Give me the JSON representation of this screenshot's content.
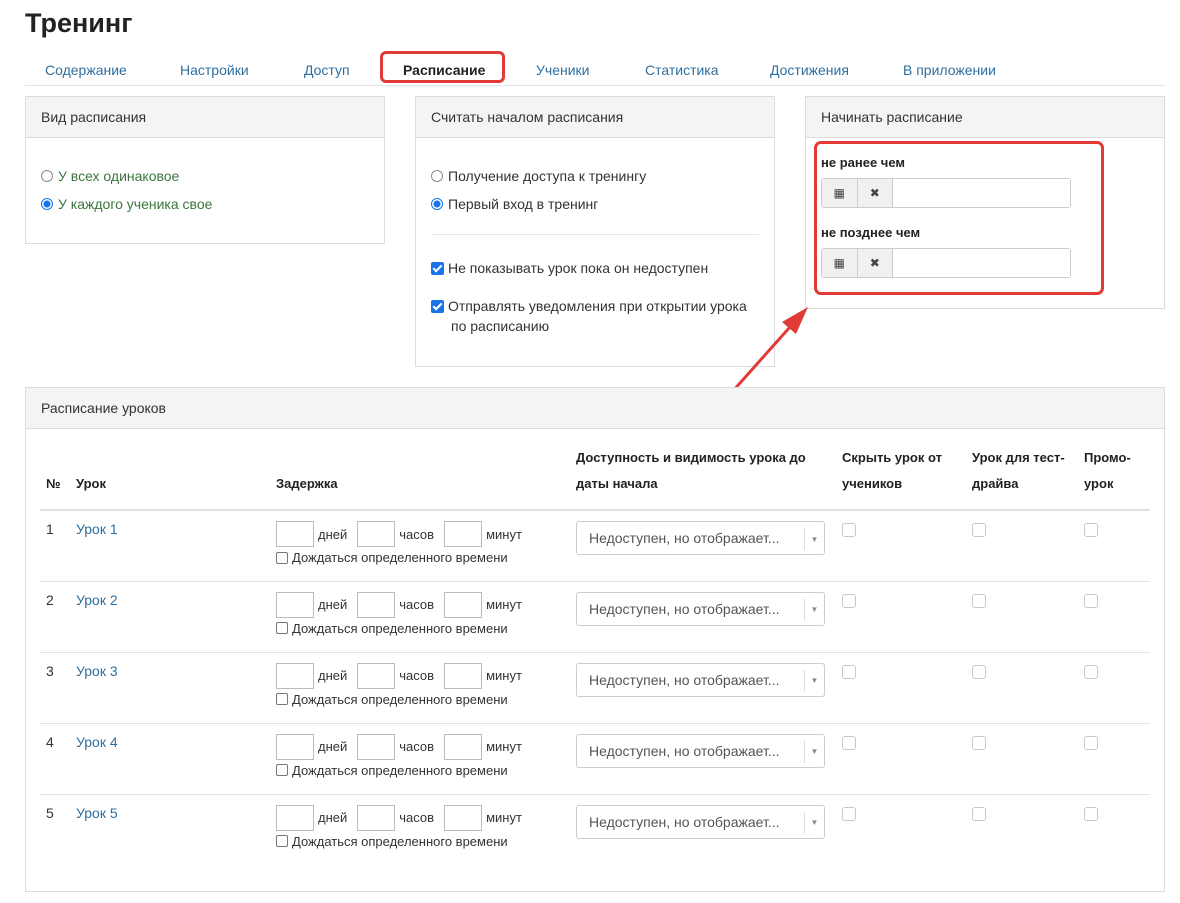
{
  "page": {
    "title": "Тренинг"
  },
  "tabs": [
    {
      "label": "Содержание"
    },
    {
      "label": "Настройки"
    },
    {
      "label": "Доступ"
    },
    {
      "label": "Расписание"
    },
    {
      "label": "Ученики"
    },
    {
      "label": "Статистика"
    },
    {
      "label": "Достижения"
    },
    {
      "label": "В приложении"
    }
  ],
  "schedule_type": {
    "heading": "Вид расписания",
    "options": [
      "У всех одинаковое",
      "У каждого ученика свое"
    ]
  },
  "schedule_start_point": {
    "heading": "Считать началом расписания",
    "options": [
      "Получение доступа к тренингу",
      "Первый вход в тренинг"
    ],
    "checkboxes": [
      {
        "label": "Не показывать урок пока он недоступен"
      },
      {
        "label_line1": "Отправлять уведомления при открытии урока",
        "label_line2": "по расписанию"
      }
    ]
  },
  "start_schedule": {
    "heading": "Начинать расписание",
    "not_earlier_label": "не ранее чем",
    "not_later_label": "не позднее чем"
  },
  "lessons": {
    "heading": "Расписание уроков",
    "columns": {
      "num": "№",
      "lesson": "Урок",
      "delay": "Задержка",
      "availability_line1": "Доступность и видимость урока до",
      "availability_line2": "даты начала",
      "hide_line1": "Скрыть урок от",
      "hide_line2": "учеников",
      "test_line1": "Урок для тест-",
      "test_line2": "драйва",
      "promo_line1": "Промо-",
      "promo_line2": "урок"
    },
    "units": {
      "days": "дней",
      "hours": "часов",
      "minutes": "минут",
      "wait": "Дождаться определенного времени"
    },
    "select_value": "Недоступен, но отображает...",
    "rows": [
      {
        "num": "1",
        "name": "Урок 1"
      },
      {
        "num": "2",
        "name": "Урок 2"
      },
      {
        "num": "3",
        "name": "Урок 3"
      },
      {
        "num": "4",
        "name": "Урок 4"
      },
      {
        "num": "5",
        "name": "Урок 5"
      }
    ]
  }
}
